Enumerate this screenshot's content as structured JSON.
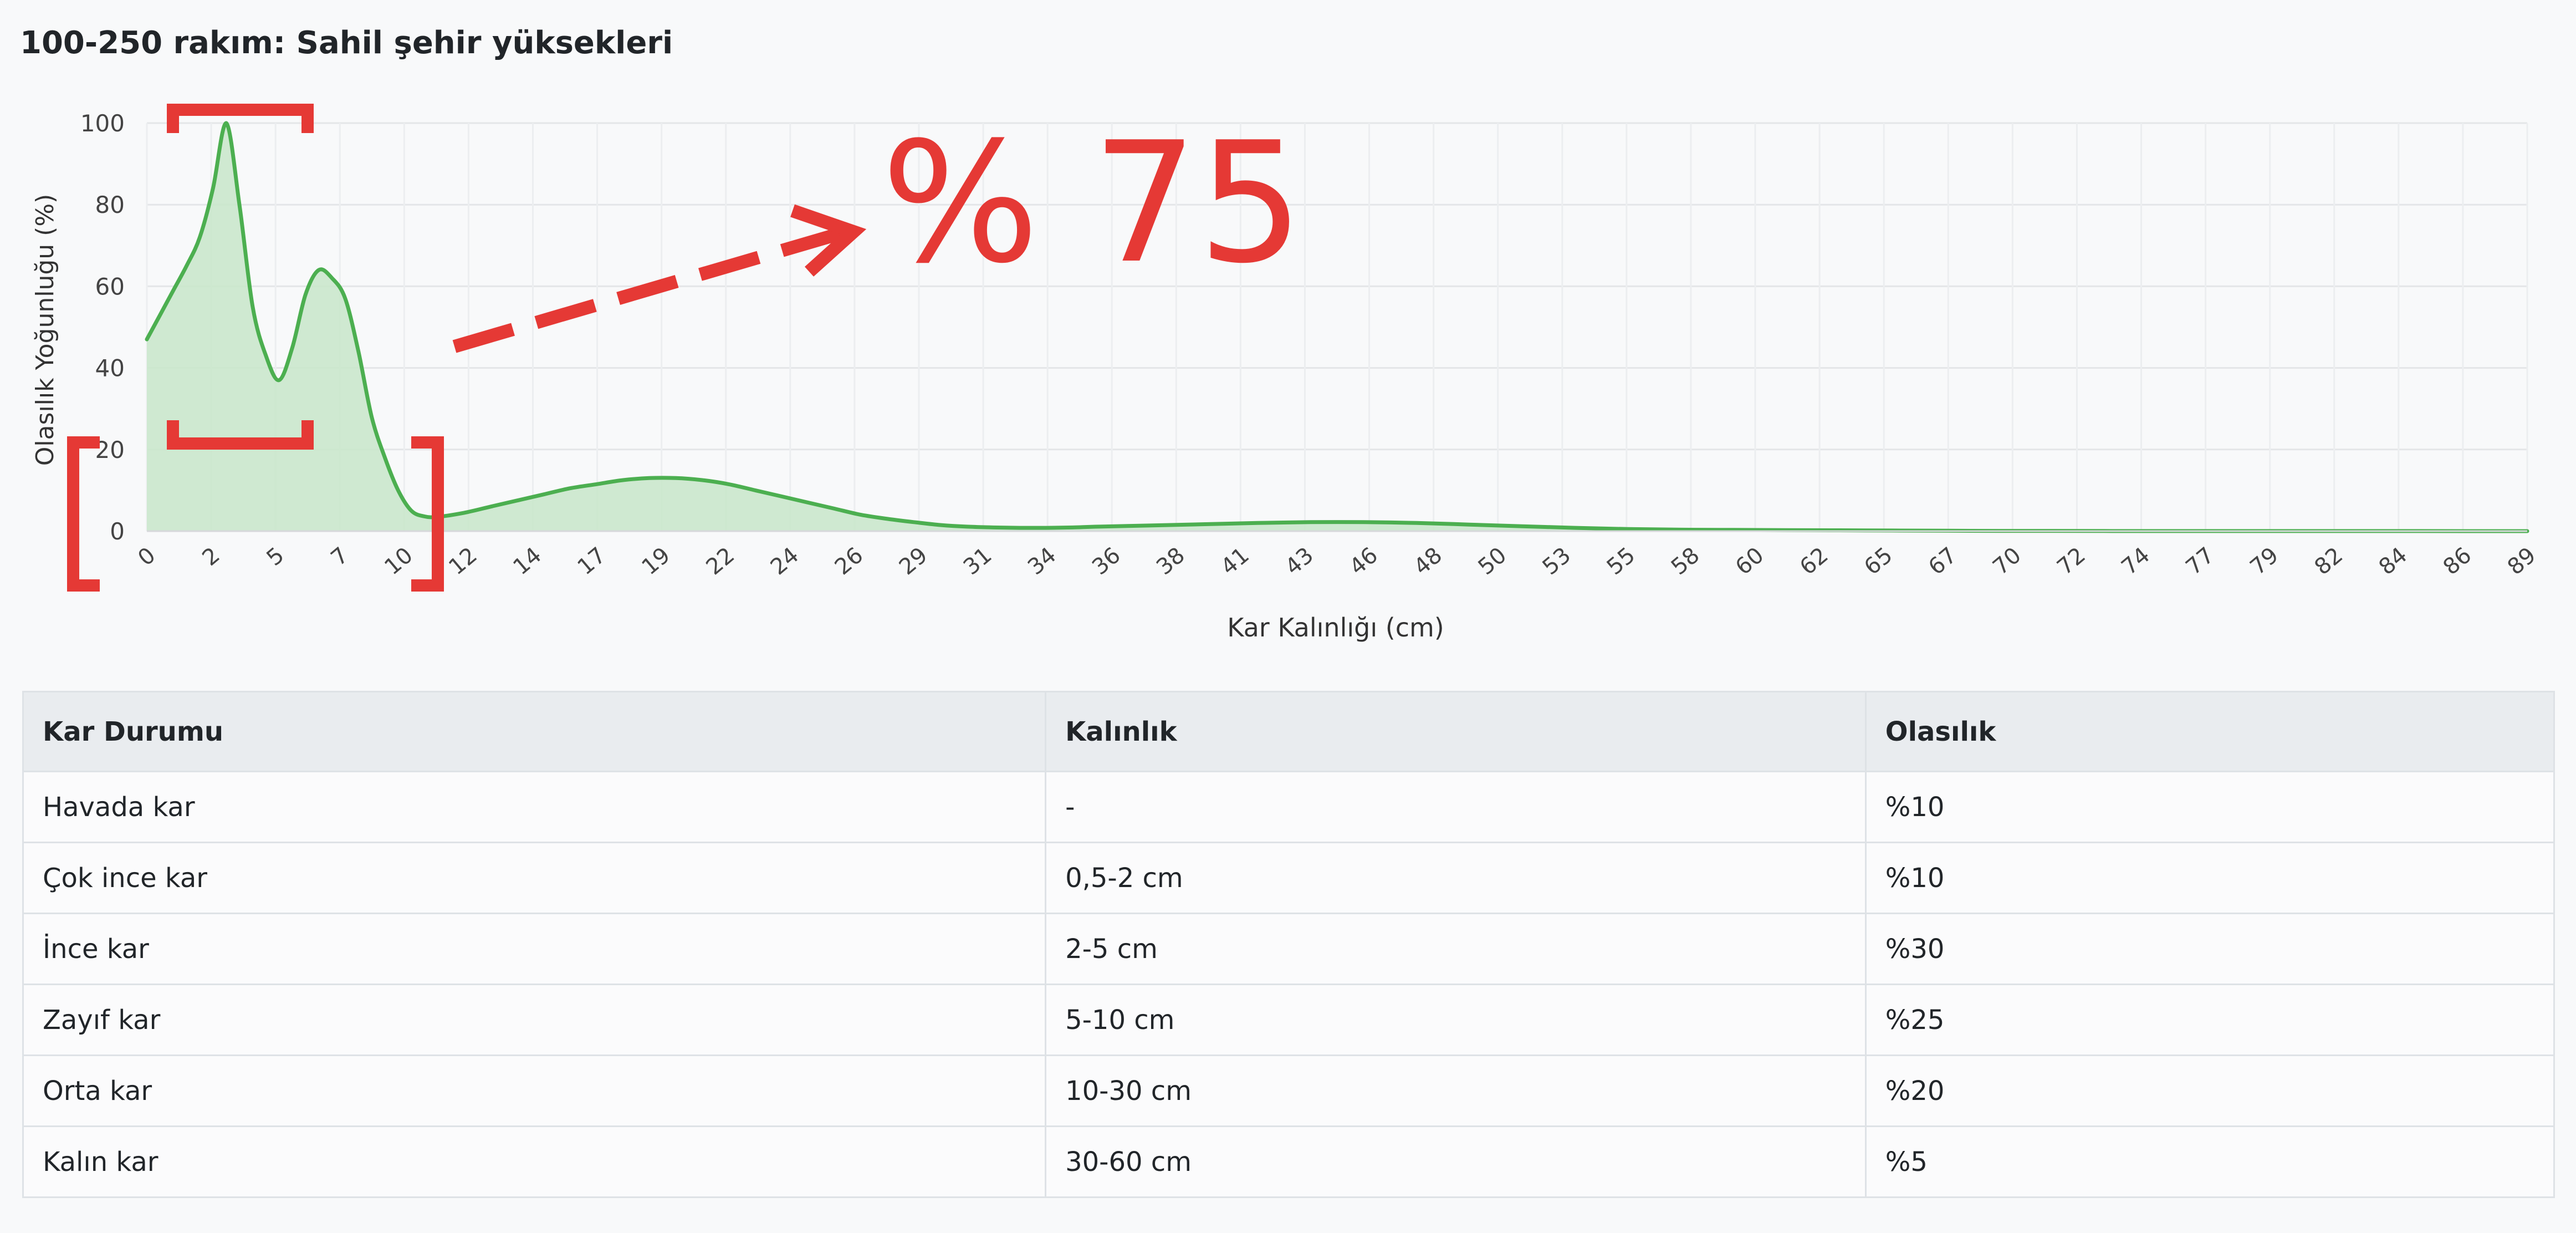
{
  "page": {
    "title": "100-250 rakım: Sahil şehir yüksekleri"
  },
  "chart_data": {
    "type": "area",
    "xlabel": "Kar Kalınlığı (cm)",
    "ylabel": "Olasılık Yoğunluğu (%)",
    "xlim": [
      0,
      90
    ],
    "ylim": [
      0,
      100
    ],
    "yticks": [
      0,
      20,
      40,
      60,
      80,
      100
    ],
    "x_tick_labels": [
      "0",
      "2",
      "5",
      "7",
      "10",
      "12",
      "14",
      "17",
      "19",
      "22",
      "24",
      "26",
      "29",
      "31",
      "34",
      "36",
      "38",
      "41",
      "43",
      "46",
      "48",
      "50",
      "53",
      "55",
      "58",
      "60",
      "62",
      "65",
      "67",
      "70",
      "72",
      "74",
      "77",
      "79",
      "82",
      "84",
      "86",
      "89"
    ],
    "grid": true,
    "line_color": "#4caf50",
    "fill_color": "#c8e6c9",
    "series": [
      {
        "x": [
          0,
          0.5,
          1,
          1.5,
          2,
          2.5,
          3,
          3.5,
          4,
          4.5,
          5,
          5.5,
          6,
          6.5,
          7,
          7.5,
          8,
          8.5,
          9,
          9.5,
          10,
          10.5,
          11,
          12,
          13,
          14,
          15,
          16,
          17,
          18,
          19,
          20,
          21,
          22,
          23,
          24,
          25,
          26,
          27,
          28,
          29,
          30,
          31,
          32,
          33,
          34,
          35,
          36,
          38,
          40,
          42,
          44,
          46,
          48,
          50,
          52,
          54,
          56,
          58,
          60,
          62,
          64,
          66,
          68,
          70,
          72,
          74,
          76,
          78,
          80,
          82,
          84,
          86,
          88,
          90
        ],
        "y": [
          47,
          53,
          59,
          65,
          72,
          84,
          100,
          80,
          55,
          43,
          37,
          45,
          58,
          64,
          62,
          57,
          44,
          28,
          18,
          10,
          5,
          3.6,
          3.5,
          4.5,
          6,
          7.5,
          9,
          10.5,
          11.5,
          12.5,
          13,
          13,
          12.5,
          11.5,
          10,
          8.5,
          7,
          5.5,
          4,
          3,
          2.2,
          1.5,
          1.1,
          0.9,
          0.8,
          0.8,
          0.9,
          1.1,
          1.4,
          1.7,
          2,
          2.2,
          2.2,
          2,
          1.6,
          1.2,
          0.8,
          0.5,
          0.35,
          0.3,
          0.25,
          0.2,
          0.15,
          0.1,
          0.05,
          0.05,
          0.03,
          0.02,
          0.02,
          0.01,
          0.01,
          0.01,
          0.01,
          0,
          0
        ]
      }
    ],
    "annotation": {
      "text": "% 75",
      "color": "#e53935"
    }
  },
  "table": {
    "headers": [
      "Kar Durumu",
      "Kalınlık",
      "Olasılık"
    ],
    "rows": [
      [
        "Havada kar",
        "-",
        "%10"
      ],
      [
        "Çok ince kar",
        "0,5-2 cm",
        "%10"
      ],
      [
        "İnce kar",
        "2-5 cm",
        "%30"
      ],
      [
        "Zayıf kar",
        "5-10 cm",
        "%25"
      ],
      [
        "Orta kar",
        "10-30 cm",
        "%20"
      ],
      [
        "Kalın kar",
        "30-60 cm",
        "%5"
      ]
    ]
  }
}
